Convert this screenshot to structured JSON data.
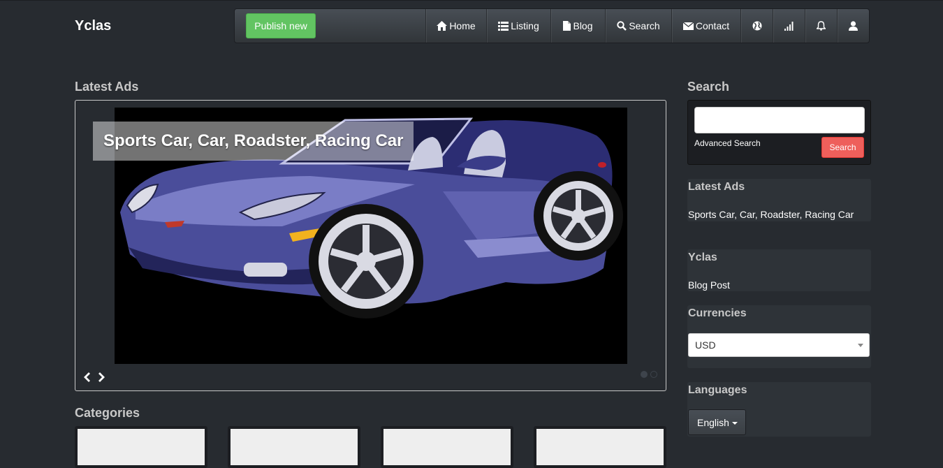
{
  "brand": "Yclas",
  "navbar": {
    "publish_label": "Publish new",
    "items": [
      {
        "label": "Home",
        "icon": "home-icon"
      },
      {
        "label": "Listing",
        "icon": "list-icon"
      },
      {
        "label": "Blog",
        "icon": "file-icon"
      },
      {
        "label": "Search",
        "icon": "search-icon"
      },
      {
        "label": "Contact",
        "icon": "envelope-icon"
      }
    ],
    "icon_items": [
      "globe-icon",
      "signal-icon",
      "bell-icon",
      "user-icon"
    ]
  },
  "main": {
    "latest_title": "Latest Ads",
    "carousel": {
      "caption": "Sports Car, Car, Roadster, Racing Car",
      "slide_count": 2,
      "active_slide": 1
    },
    "categories_title": "Categories"
  },
  "sidebar": {
    "search": {
      "title": "Search",
      "input_value": "",
      "advanced_label": "Advanced Search",
      "button_label": "Search"
    },
    "latest_ads": {
      "title": "Latest Ads",
      "items": [
        "Sports Car, Car, Roadster, Racing Car"
      ]
    },
    "blog": {
      "title": "Yclas",
      "items": [
        "Blog Post"
      ]
    },
    "currencies": {
      "title": "Currencies",
      "selected": "USD"
    },
    "languages": {
      "title": "Languages",
      "selected": "English"
    }
  },
  "colors": {
    "background": "#272b30",
    "publish_button": "#62c462",
    "search_button": "#ee5f5b",
    "car_body": "#4a4d9a"
  }
}
